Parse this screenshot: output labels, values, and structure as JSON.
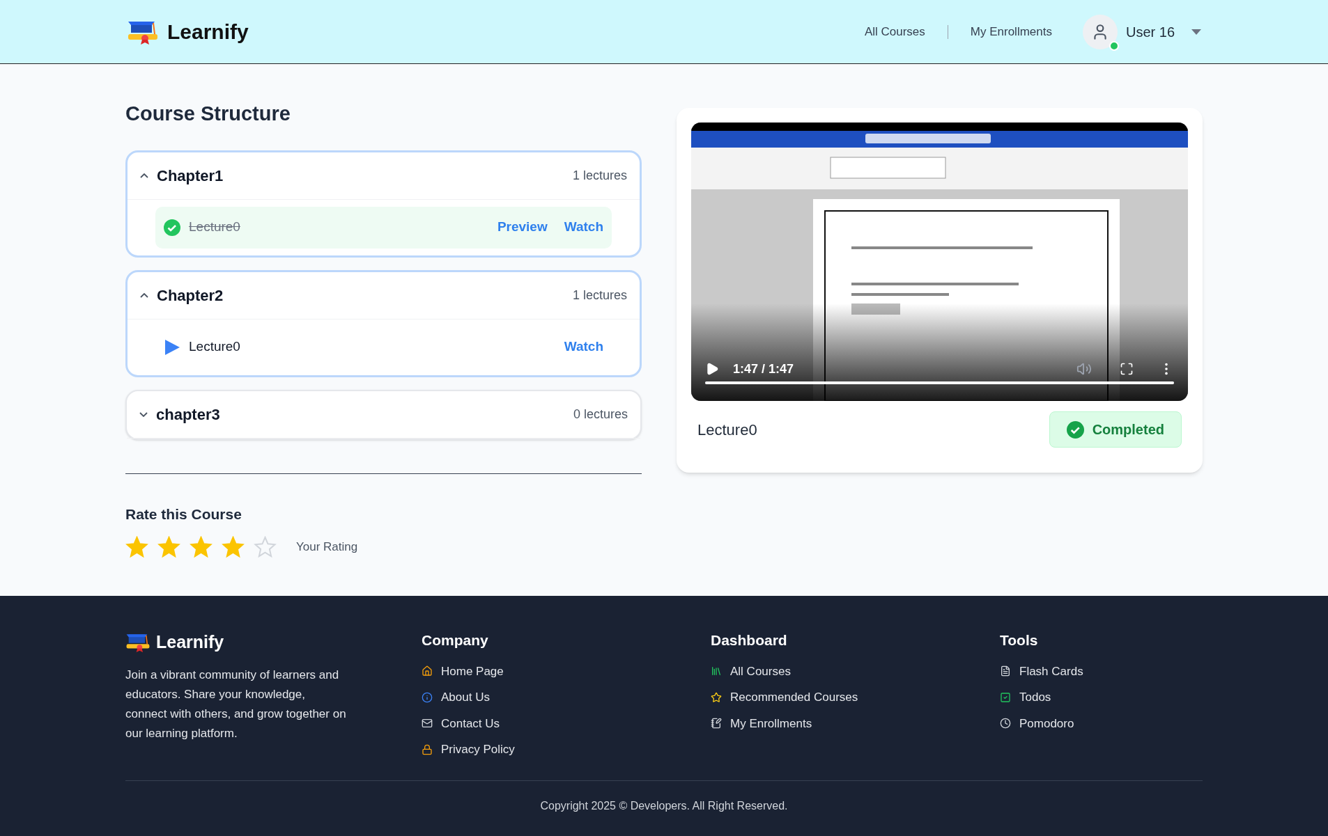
{
  "header": {
    "brand": "Learnify",
    "nav": [
      "All Courses",
      "My Enrollments"
    ],
    "user": {
      "name": "User 16",
      "online": true
    }
  },
  "page_title": "Course Structure",
  "chapters": [
    {
      "title": "Chapter1",
      "count": "1 lectures",
      "expanded": true,
      "lectures": [
        {
          "title": "Lecture0",
          "completed": true,
          "actions": [
            "Preview",
            "Watch"
          ]
        }
      ]
    },
    {
      "title": "Chapter2",
      "count": "1 lectures",
      "expanded": true,
      "lectures": [
        {
          "title": "Lecture0",
          "completed": false,
          "actions": [
            "Watch"
          ]
        }
      ]
    },
    {
      "title": "chapter3",
      "count": "0 lectures",
      "expanded": false
    }
  ],
  "rating": {
    "title": "Rate this Course",
    "stars": 4,
    "caption": "Your Rating"
  },
  "player": {
    "time": "1:47 / 1:47",
    "level": 1,
    "lecture_title": "Lecture0",
    "status": "Completed",
    "completed": true
  },
  "footer": {
    "brand": "Learnify",
    "about": "Join a vibrant community of learners and educators. Share your knowledge, connect with others, and grow together on our learning platform.",
    "columns": [
      {
        "title": "Company",
        "links": [
          "Home Page",
          "About Us",
          "Contact Us",
          "Privacy Policy"
        ]
      },
      {
        "title": "Dashboard",
        "links": [
          "All Courses",
          "Recommended Courses",
          "My Enrollments"
        ]
      },
      {
        "title": "Tools",
        "links": [
          "Flash Cards",
          "Todos",
          "Pomodoro"
        ]
      }
    ],
    "copyright": "Copyright 2025 © Developers. All Right Reserved."
  }
}
